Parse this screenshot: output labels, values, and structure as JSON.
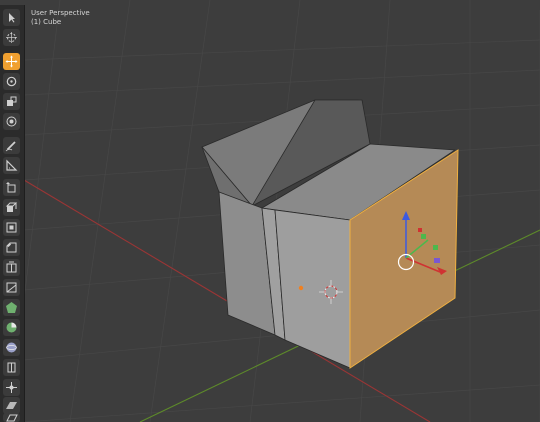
{
  "viewport": {
    "view_name": "User Perspective",
    "object_label": "(1) Cube"
  },
  "toolbar": {
    "tools": [
      {
        "name": "select-tool",
        "icon": "cursor-arrow-icon",
        "active": false
      },
      {
        "name": "cursor-tool",
        "icon": "3d-cursor-icon",
        "active": false
      },
      {
        "name": "move-tool",
        "icon": "move-arrows-icon",
        "active": true
      },
      {
        "name": "rotate-tool",
        "icon": "rotate-icon",
        "active": false
      },
      {
        "name": "scale-tool",
        "icon": "scale-icon",
        "active": false
      },
      {
        "name": "transform-tool",
        "icon": "transform-icon",
        "active": false
      },
      {
        "name": "annotate-tool",
        "icon": "pencil-icon",
        "active": false
      },
      {
        "name": "measure-tool",
        "icon": "ruler-icon",
        "active": false
      },
      {
        "name": "add-cube-tool",
        "icon": "add-cube-icon",
        "active": false
      },
      {
        "name": "extrude-tool",
        "icon": "extrude-icon",
        "active": false
      },
      {
        "name": "inset-tool",
        "icon": "inset-icon",
        "active": false
      },
      {
        "name": "bevel-tool",
        "icon": "bevel-icon",
        "active": false
      },
      {
        "name": "loop-cut-tool",
        "icon": "loop-cut-icon",
        "active": false
      },
      {
        "name": "knife-tool",
        "icon": "knife-icon",
        "active": false
      },
      {
        "name": "poly-build-tool",
        "icon": "poly-build-icon",
        "active": false
      },
      {
        "name": "spin-tool",
        "icon": "spin-icon",
        "active": false
      },
      {
        "name": "smooth-tool",
        "icon": "smooth-sphere-icon",
        "active": false
      },
      {
        "name": "edge-slide-tool",
        "icon": "edge-slide-icon",
        "active": false
      },
      {
        "name": "shrink-fatten-tool",
        "icon": "shrink-fatten-icon",
        "active": false
      },
      {
        "name": "shear-tool",
        "icon": "shear-icon",
        "active": false
      },
      {
        "name": "rip-tool",
        "icon": "rip-region-icon",
        "active": false
      }
    ]
  },
  "colors": {
    "accent": "#f0a030",
    "x_axis": "#c03838",
    "y_axis": "#6a9a2a",
    "selected_face": "#b58a56",
    "selection_outline": "#f0b040"
  }
}
